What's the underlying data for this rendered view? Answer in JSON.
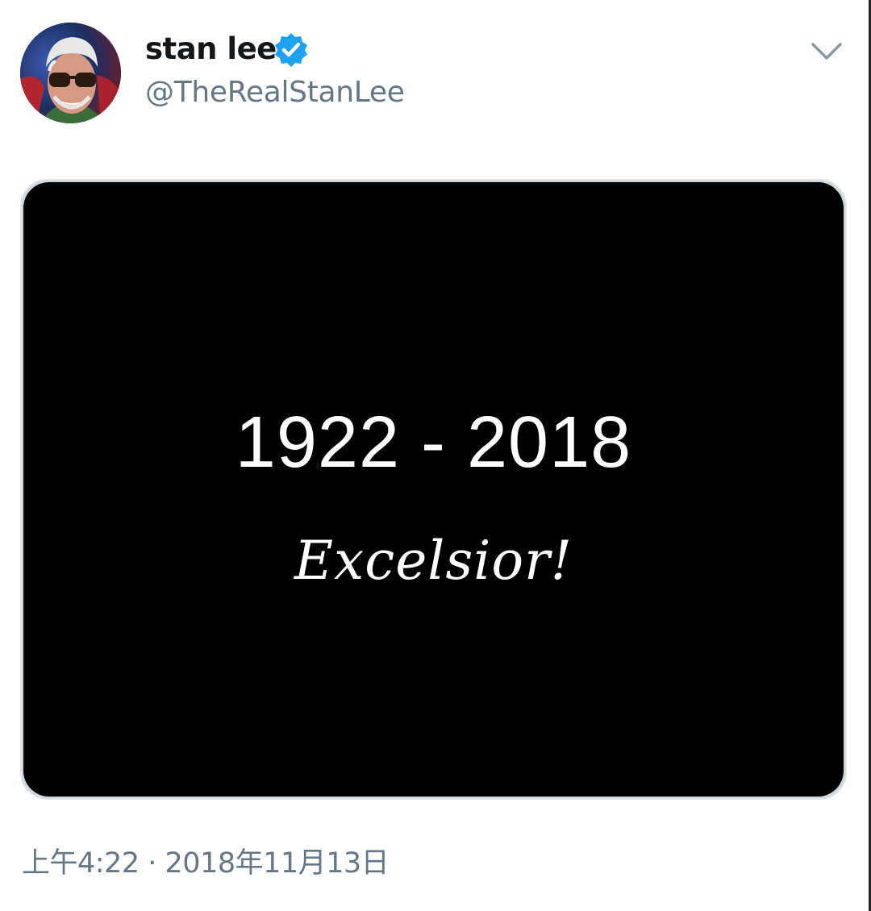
{
  "author": {
    "display_name": "stan lee",
    "handle": "@TheRealStanLee",
    "verified": true,
    "avatar_icon": "avatar-photo"
  },
  "menu": {
    "icon": "chevron-down-icon"
  },
  "media": {
    "years": "1922 - 2018",
    "motto": "Excelsior!",
    "background_color": "#000000"
  },
  "meta": {
    "time": "上午4:22",
    "separator": "·",
    "date": "2018年11月13日"
  },
  "colors": {
    "verified_blue": "#1da1f2",
    "secondary_text": "#657786",
    "primary_text": "#14171a"
  }
}
